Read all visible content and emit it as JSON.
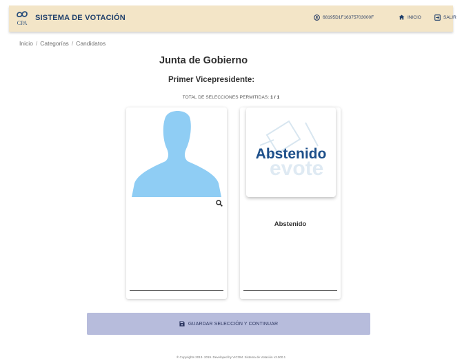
{
  "header": {
    "logo_text": "CPA",
    "title": "SISTEMA DE VOTACIÓN",
    "user_id": "68195D1F16375703000F",
    "home_label": "INICIO",
    "exit_label": "SALIR"
  },
  "breadcrumb": [
    "Inicio",
    "Categorías",
    "Candidatos"
  ],
  "page": {
    "title": "Junta de Gobierno",
    "position": "Primer Vicepresidente:",
    "selections_label": "TOTAL DE SELECCIONES PERMITIDAS:",
    "selections_value": "1 / 1"
  },
  "candidates": [
    {
      "name": "",
      "image": "person-silhouette"
    },
    {
      "name": "Abstenido",
      "image_text": "Abstenido",
      "image_watermark": "evote"
    }
  ],
  "actions": {
    "save_label": "GUARDAR SELECCIÓN Y CONTINUAR"
  },
  "footer": {
    "text": "® Copyrights 2013- 2019. Developed by VICOM. Sistema de Votación v3.000.1"
  },
  "colors": {
    "header_bg": "#f3e5c7",
    "header_text": "#1f3f6b",
    "silhouette": "#8fcdf4",
    "button_bg": "#b7bcdc",
    "abstain_text": "#1d4f8a"
  }
}
